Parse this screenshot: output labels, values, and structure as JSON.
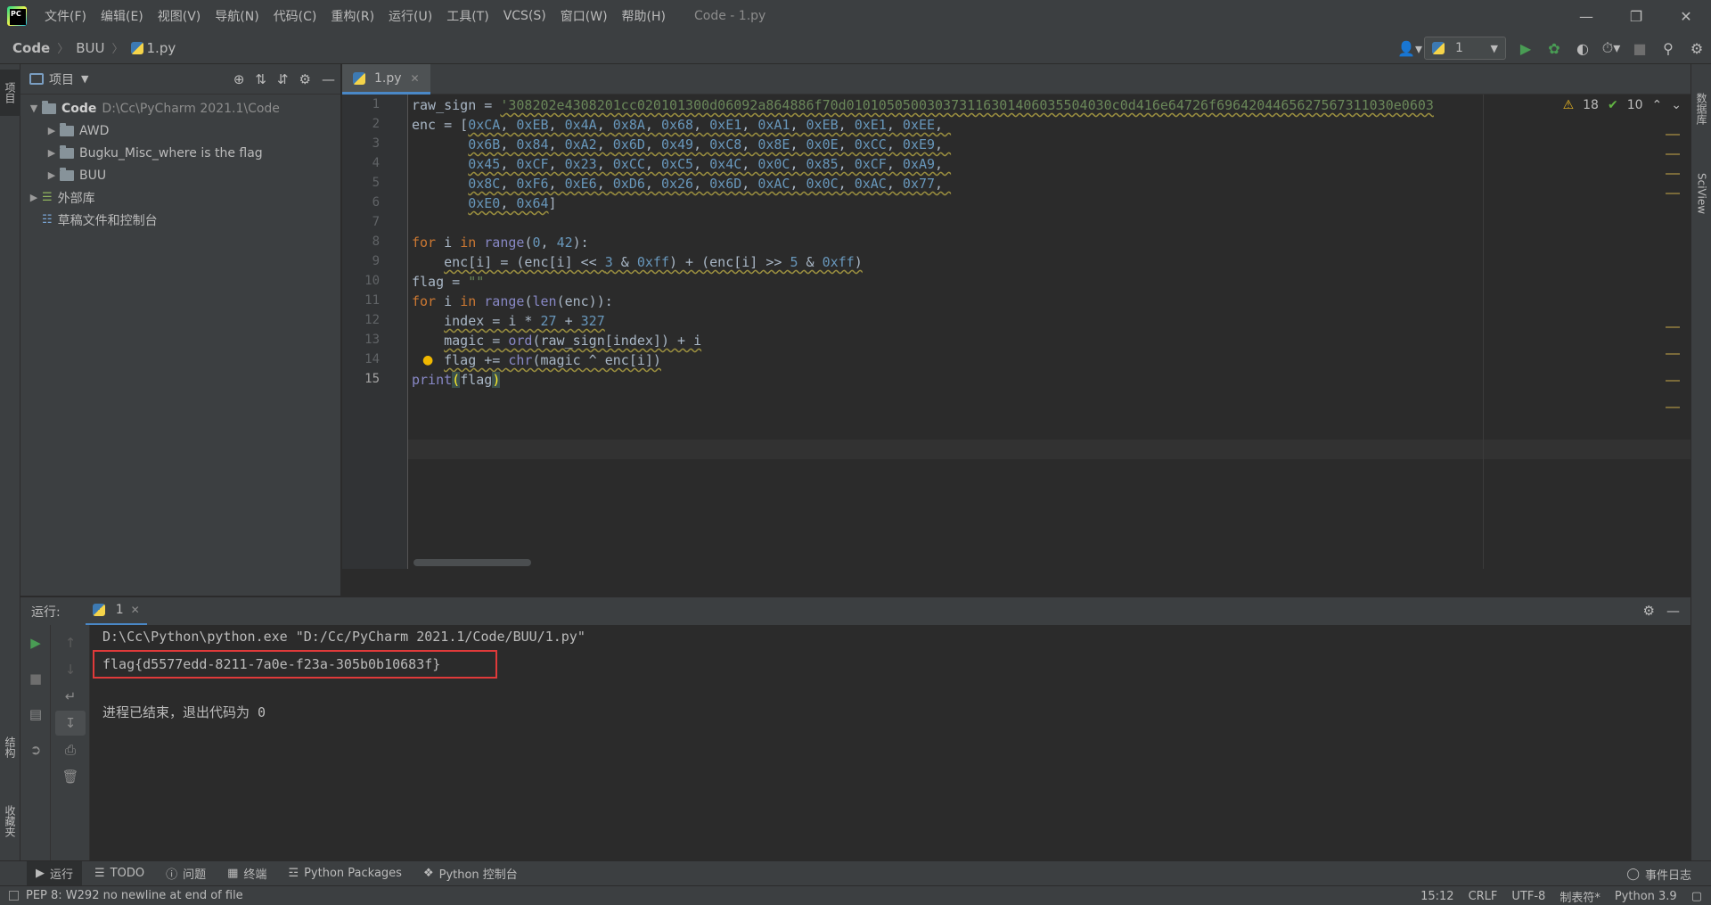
{
  "menu": [
    "文件(F)",
    "编辑(E)",
    "视图(V)",
    "导航(N)",
    "代码(C)",
    "重构(R)",
    "运行(U)",
    "工具(T)",
    "VCS(S)",
    "窗口(W)",
    "帮助(H)"
  ],
  "window_title": "Code - 1.py",
  "breadcrumb": [
    "Code",
    "BUU",
    "1.py"
  ],
  "run_config": "1",
  "left_stripe": {
    "project": "项目",
    "structure": "结构",
    "favorites": "收藏夹"
  },
  "right_stripe": {
    "database": "数据库",
    "sciview": "SciView"
  },
  "project_panel": {
    "title": "项目",
    "root": {
      "name": "Code",
      "path": "D:\\Cc\\PyCharm 2021.1\\Code"
    },
    "folders": [
      "AWD",
      "Bugku_Misc_where is the flag",
      "BUU"
    ],
    "external_libs": "外部库",
    "scratches": "草稿文件和控制台"
  },
  "editor": {
    "tab": "1.py",
    "warnings": "18",
    "weak_warnings": "10",
    "line_numbers": [
      "1",
      "2",
      "3",
      "4",
      "5",
      "6",
      "7",
      "8",
      "9",
      "10",
      "11",
      "12",
      "13",
      "14",
      "15"
    ],
    "raw_sign_value": "'308202e4308201cc020101300d06092a864886f70d010105050030373116301406035504030c0d416e64726f6964204465627567311030e0603",
    "enc_rows": [
      [
        "0xCA",
        "0xEB",
        "0x4A",
        "0x8A",
        "0x68",
        "0xE1",
        "0xA1",
        "0xEB",
        "0xE1",
        "0xEE"
      ],
      [
        "0x6B",
        "0x84",
        "0xA2",
        "0x6D",
        "0x49",
        "0xC8",
        "0x8E",
        "0x0E",
        "0xCC",
        "0xE9"
      ],
      [
        "0x45",
        "0xCF",
        "0x23",
        "0xCC",
        "0xC5",
        "0x4C",
        "0x0C",
        "0x85",
        "0xCF",
        "0xA9"
      ],
      [
        "0x8C",
        "0xF6",
        "0xE6",
        "0xD6",
        "0x26",
        "0x6D",
        "0xAC",
        "0x0C",
        "0xAC",
        "0x77"
      ],
      [
        "0xE0",
        "0x64"
      ]
    ]
  },
  "run_panel": {
    "label": "运行:",
    "tab": "1",
    "command": "D:\\Cc\\Python\\python.exe \"D:/Cc/PyCharm 2021.1/Code/BUU/1.py\"",
    "output": "flag{d5577edd-8211-7a0e-f23a-305b0b10683f}",
    "exit": "进程已结束，退出代码为 0"
  },
  "tool_tabs": [
    "运行",
    "TODO",
    "问题",
    "终端",
    "Python Packages",
    "Python 控制台"
  ],
  "event_log": "事件日志",
  "status": {
    "message": "PEP 8: W292 no newline at end of file",
    "position": "15:12",
    "line_sep": "CRLF",
    "encoding": "UTF-8",
    "indent": "制表符*",
    "interpreter": "Python 3.9"
  },
  "colors": {
    "accent": "#4a88c7",
    "highlight_box": "#e03a3a",
    "run_green": "#499c54"
  }
}
